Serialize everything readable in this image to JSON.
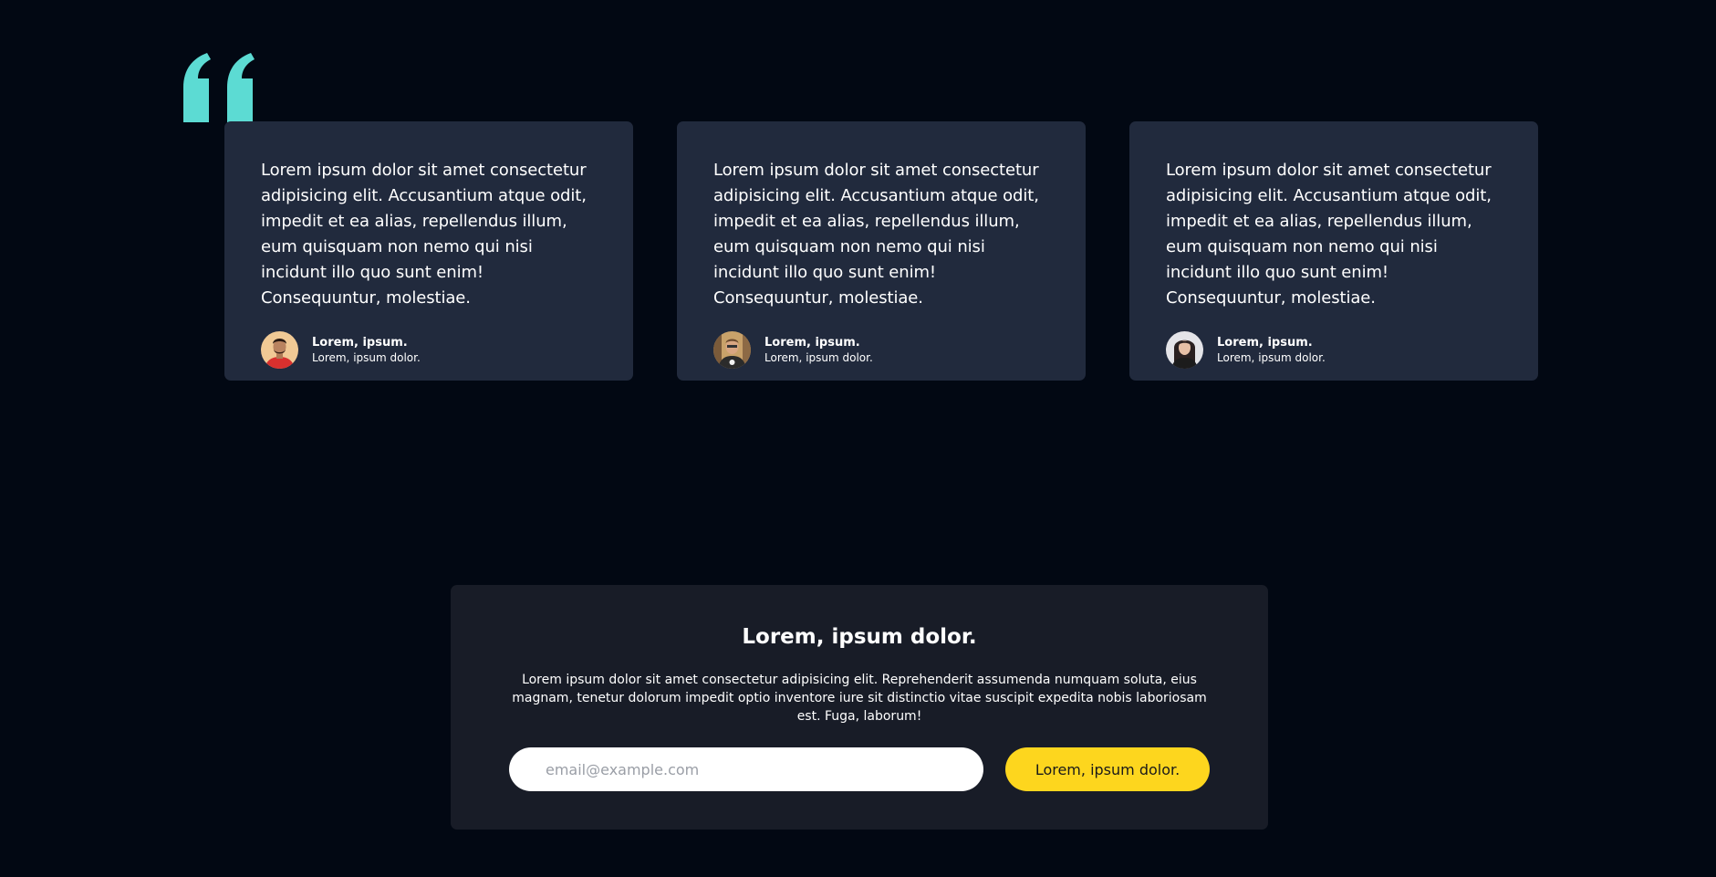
{
  "colors": {
    "background": "#020813",
    "card_background": "#212a3d",
    "quote_mark": "#5cdbd3",
    "newsletter_background": "#181c27",
    "button": "#fdd61e"
  },
  "quote_icon": "quote-icon",
  "testimonials": [
    {
      "text": "Lorem ipsum dolor sit amet consectetur adipisicing elit. Accusantium atque odit, impedit et ea alias, repellendus illum, eum quisquam non nemo qui nisi incidunt illo quo sunt enim! Consequuntur, molestiae.",
      "name": "Lorem, ipsum.",
      "role": "Lorem, ipsum dolor."
    },
    {
      "text": "Lorem ipsum dolor sit amet consectetur adipisicing elit. Accusantium atque odit, impedit et ea alias, repellendus illum, eum quisquam non nemo qui nisi incidunt illo quo sunt enim! Consequuntur, molestiae.",
      "name": "Lorem, ipsum.",
      "role": "Lorem, ipsum dolor."
    },
    {
      "text": "Lorem ipsum dolor sit amet consectetur adipisicing elit. Accusantium atque odit, impedit et ea alias, repellendus illum, eum quisquam non nemo qui nisi incidunt illo quo sunt enim! Consequuntur, molestiae.",
      "name": "Lorem, ipsum.",
      "role": "Lorem, ipsum dolor."
    }
  ],
  "newsletter": {
    "title": "Lorem, ipsum dolor.",
    "text": "Lorem ipsum dolor sit amet consectetur adipisicing elit. Reprehenderit assumenda numquam soluta, eius magnam, tenetur dolorum impedit optio inventore iure sit distinctio vitae suscipit expedita nobis laboriosam est. Fuga, laborum!",
    "email_placeholder": "email@example.com",
    "email_value": "",
    "button_label": "Lorem, ipsum dolor."
  }
}
